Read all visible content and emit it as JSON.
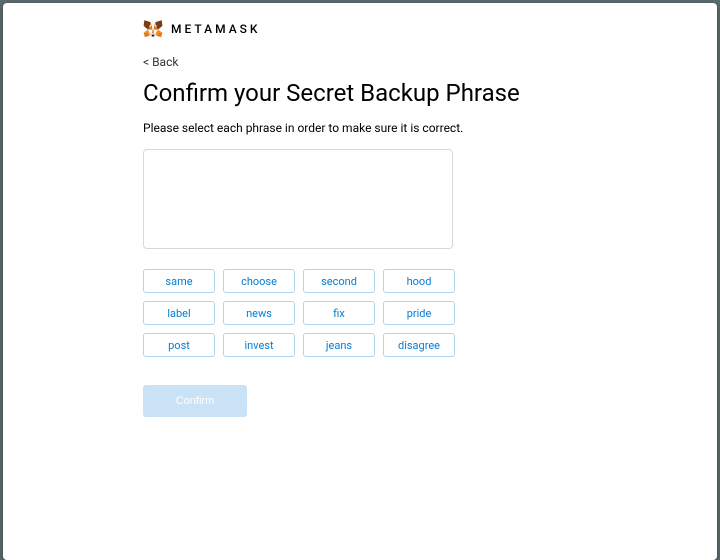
{
  "header": {
    "brand": "METAMASK"
  },
  "nav": {
    "back": "< Back"
  },
  "title": "Confirm your Secret Backup Phrase",
  "subtitle": "Please select each phrase in order to make sure it is correct.",
  "words": [
    "same",
    "choose",
    "second",
    "hood",
    "label",
    "news",
    "fix",
    "pride",
    "post",
    "invest",
    "jeans",
    "disagree"
  ],
  "confirm_label": "Confirm"
}
